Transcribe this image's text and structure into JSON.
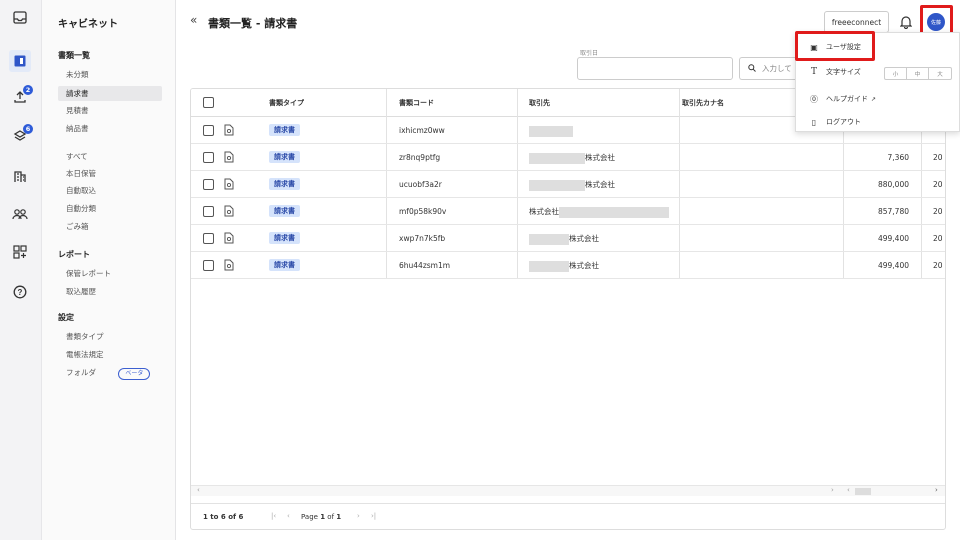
{
  "app": {
    "name": "キャビネット"
  },
  "header": {
    "title": "書類一覧 - 請求書",
    "collapse_icon": "double-chevron-left",
    "connect_button": "freeeconnect",
    "avatar_text": "佐藤"
  },
  "sidebar": {
    "sections": [
      {
        "title": "書類一覧",
        "items": [
          "未分類",
          "請求書",
          "見積書",
          "納品書"
        ],
        "active": "請求書"
      },
      {
        "title": "",
        "items": [
          "すべて",
          "本日保管",
          "自動取込",
          "自動分類",
          "ごみ箱"
        ]
      },
      {
        "title": "レポート",
        "items": [
          "保管レポート",
          "取込履歴"
        ]
      },
      {
        "title": "設定",
        "items": [
          "書類タイプ",
          "電帳法規定",
          "フォルダ"
        ]
      }
    ],
    "beta_badge": "ベータ"
  },
  "rail": {
    "badges": {
      "upload": "2",
      "stack": "6"
    }
  },
  "filters": {
    "date_label": "取引日",
    "search_placeholder": "入力して"
  },
  "table": {
    "columns": [
      "書類タイプ",
      "書類コード",
      "取引先",
      "取引先カナ名"
    ],
    "rows": [
      {
        "type": "請求書",
        "code": "ixhicmz0ww",
        "vendor": "",
        "amount": "",
        "year": ""
      },
      {
        "type": "請求書",
        "code": "zr8nq9ptfg",
        "vendor": "株式会社",
        "amount": "7,360",
        "year": "20"
      },
      {
        "type": "請求書",
        "code": "ucuobf3a2r",
        "vendor": "株式会社",
        "amount": "880,000",
        "year": "20"
      },
      {
        "type": "請求書",
        "code": "mf0p58k90v",
        "vendor": "株式会社",
        "amount": "857,780",
        "year": "20"
      },
      {
        "type": "請求書",
        "code": "xwp7n7k5fb",
        "vendor": "株式会社",
        "amount": "499,400",
        "year": "20"
      },
      {
        "type": "請求書",
        "code": "6hu44zsm1m",
        "vendor": "株式会社",
        "amount": "499,400",
        "year": "20"
      }
    ]
  },
  "pagination": {
    "range": "1 to 6 of 6",
    "page_prefix": "Page",
    "page_current": "1",
    "page_of": "of",
    "page_total": "1"
  },
  "menu": {
    "items": [
      {
        "label": "ユーザ設定",
        "icon": "user-card-icon"
      },
      {
        "label": "文字サイズ",
        "icon": "text-size-icon"
      },
      {
        "label": "ヘルプガイド",
        "icon": "help-circle-icon"
      },
      {
        "label": "ログアウト",
        "icon": "logout-icon"
      }
    ],
    "text_sizes": [
      "小",
      "中",
      "大"
    ]
  },
  "colors": {
    "accent": "#2f56c8",
    "highlight": "#e01b1b",
    "tag_bg": "#d5e3fb"
  }
}
